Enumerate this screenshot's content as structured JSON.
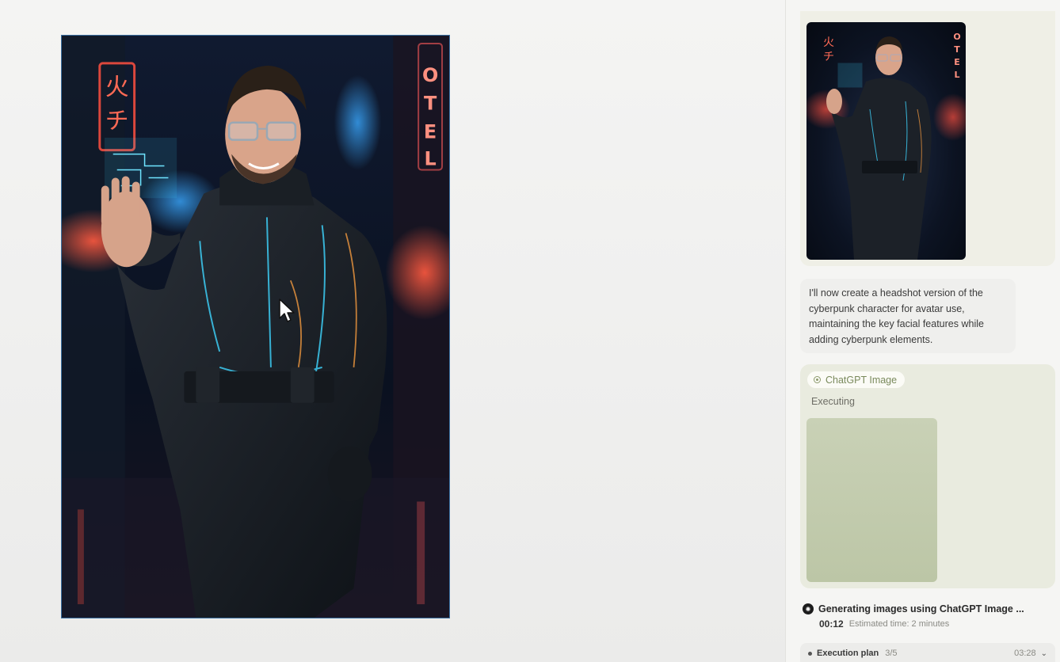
{
  "canvas": {
    "image_alt": "Cyberpunk character portrait waving in neon-lit rainy street",
    "sign_left": "火チ",
    "sign_right": "OTEL"
  },
  "panel": {
    "preview_thumb_alt": "Previous generated full-body cyberpunk image",
    "message": "I'll now create a headshot version of the cyberpunk character for avatar use, maintaining the key facial features while adding cyberpunk elements.",
    "tool": {
      "name": "ChatGPT Image",
      "status": "Executing"
    },
    "generation": {
      "title": "Generating images using ChatGPT Image ...",
      "elapsed": "00:12",
      "estimate": "Estimated time: 2 minutes"
    },
    "plan": {
      "label": "Execution plan",
      "progress": "3/5",
      "time": "03:28"
    }
  },
  "colors": {
    "neon_red": "#ff4a3d",
    "neon_cyan": "#3fd6ff",
    "tool_green": "#7a8a5c"
  }
}
